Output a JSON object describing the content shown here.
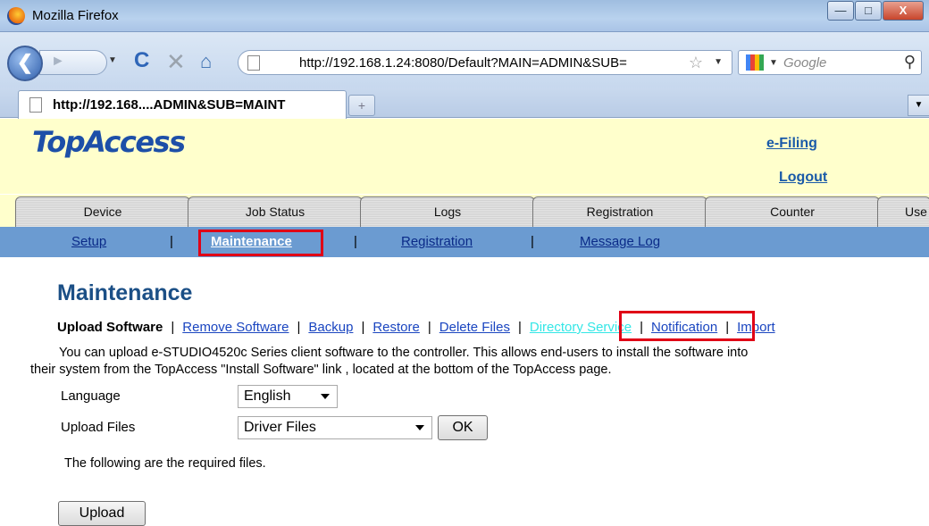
{
  "window": {
    "title": "Mozilla Firefox",
    "minimize_glyph": "—",
    "maximize_glyph": "□",
    "close_glyph": "X"
  },
  "navbar": {
    "url": "http://192.168.1.24:8080/Default?MAIN=ADMIN&SUB=",
    "search_placeholder": "Google"
  },
  "tab": {
    "label": "http://192.168....ADMIN&SUB=MAINT"
  },
  "header": {
    "logo": "TopAccess",
    "efiling": "e-Filing",
    "logout": "Logout"
  },
  "main_tabs": [
    "Device",
    "Job Status",
    "Logs",
    "Registration",
    "Counter",
    "Use"
  ],
  "sub_nav": {
    "items": [
      "Setup",
      "Maintenance",
      "Registration",
      "Message Log"
    ],
    "separator": "|",
    "active": "Maintenance"
  },
  "content": {
    "title": "Maintenance",
    "menu": {
      "current": "Upload Software",
      "links": [
        "Remove Software",
        "Backup",
        "Restore",
        "Delete Files",
        "Directory Service",
        "Notification",
        "Import"
      ],
      "separator": "|"
    },
    "description_line1": "You can upload e-STUDIO4520c Series client software to the controller. This allows end-users to install the software into",
    "description_line2": "their system from the TopAccess \"Install Software\" link , located at the bottom of the TopAccess page.",
    "language_label": "Language",
    "language_value": "English",
    "upload_files_label": "Upload Files",
    "upload_files_value": "Driver Files",
    "ok_label": "OK",
    "required_text": "The following are the required files.",
    "upload_label": "Upload"
  },
  "colors": {
    "highlight_box": "#e00016",
    "subnav_bg": "#6b9bd1",
    "header_bg": "#ffffcc"
  }
}
